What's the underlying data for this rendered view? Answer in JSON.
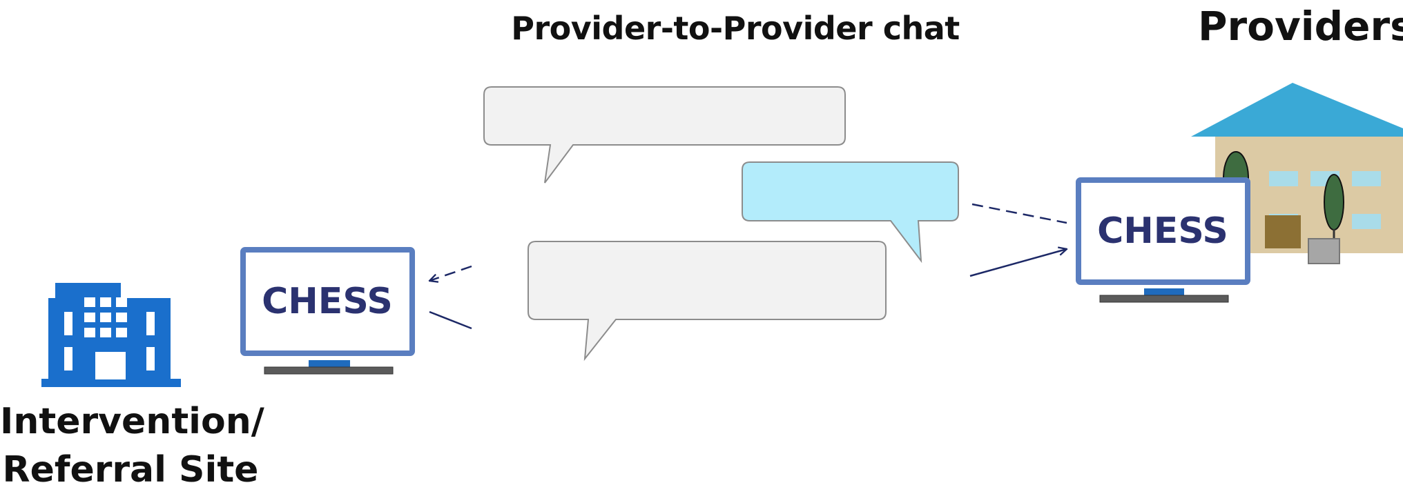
{
  "title": "Provider-to-Provider chat",
  "providers_label": "Providers",
  "site_label_line1": "Intervention/",
  "site_label_line2": "Referral Site",
  "monitor_label": "CHESS",
  "colors": {
    "monitor_frame": "#5a7ec0",
    "monitor_text": "#2b3270",
    "building_blue": "#1a6fcc",
    "bubble_gray": "#f2f2f2",
    "bubble_blue": "#b3ecfb",
    "roof": "#3aa9d6",
    "arrow": "#1c2866"
  },
  "icons": {
    "site": "office-building-icon",
    "providers": "house-icon",
    "computer": "computer-monitor-icon"
  }
}
